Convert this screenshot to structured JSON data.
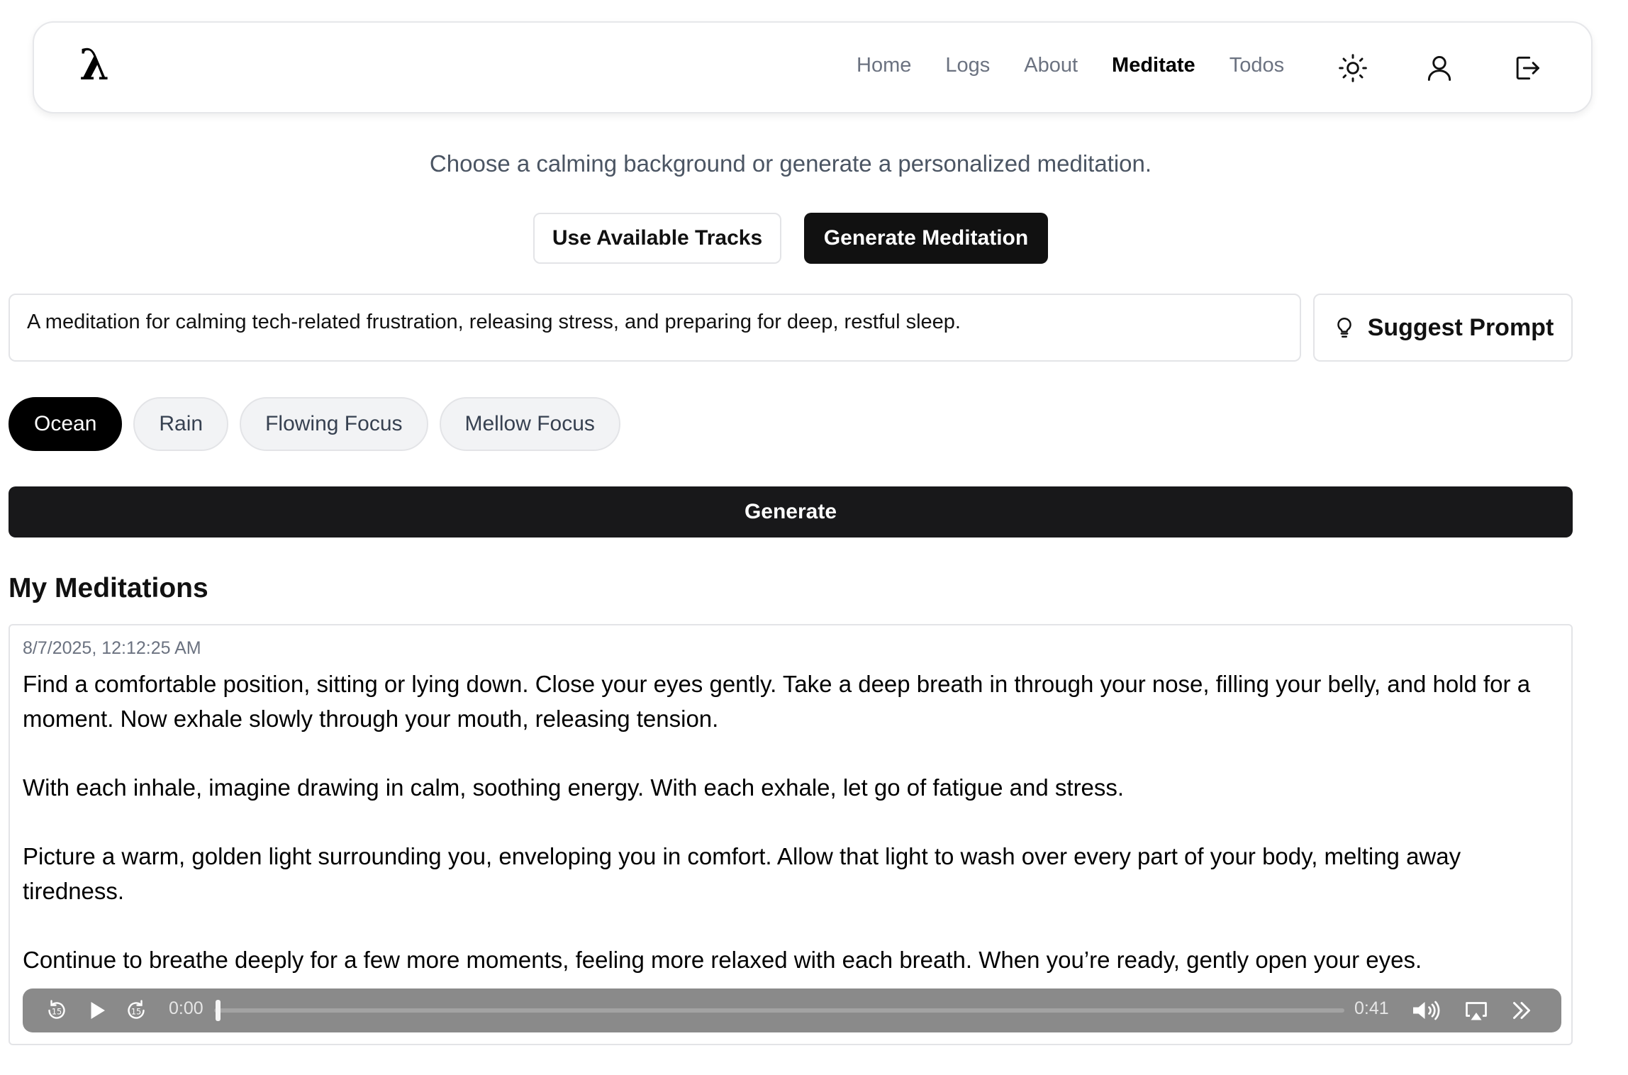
{
  "navbar": {
    "logo": "λ",
    "links": [
      "Home",
      "Logs",
      "About",
      "Meditate",
      "Todos"
    ],
    "active": "Meditate",
    "icons": [
      "sun-icon",
      "user-icon",
      "logout-icon"
    ]
  },
  "subtitle": "Choose a calming background or generate a personalized meditation.",
  "mode_buttons": {
    "available": "Use Available Tracks",
    "generate": "Generate Meditation"
  },
  "prompt": {
    "value": "A meditation for calming tech-related frustration, releasing stress, and preparing for deep, restful sleep."
  },
  "suggest_button": {
    "label": "Suggest Prompt",
    "icon": "lightbulb-icon"
  },
  "backgrounds": {
    "items": [
      "Ocean",
      "Rain",
      "Flowing Focus",
      "Mellow Focus"
    ],
    "selected": "Ocean"
  },
  "generate_button": "Generate",
  "section_title": "My Meditations",
  "meditations": [
    {
      "timestamp": "8/7/2025, 12:12:25 AM",
      "paragraphs": [
        "Find a comfortable position, sitting or lying down. Close your eyes gently. Take a deep breath in through your nose, filling your belly, and hold for a moment. Now exhale slowly through your mouth, releasing tension.",
        "With each inhale, imagine drawing in calm, soothing energy. With each exhale, let go of fatigue and stress.",
        "Picture a warm, golden light surrounding you, enveloping you in comfort. Allow that light to wash over every part of your body, melting away tiredness.",
        "Continue to breathe deeply for a few more moments, feeling more relaxed with each breath. When you’re ready, gently open your eyes."
      ],
      "player": {
        "current_time": "0:00",
        "duration": "0:41",
        "progress": 0,
        "icons": [
          "skip-back-15-icon",
          "play-icon",
          "skip-forward-15-icon",
          "volume-icon",
          "airplay-icon",
          "playback-speed-icon"
        ]
      }
    }
  ]
}
